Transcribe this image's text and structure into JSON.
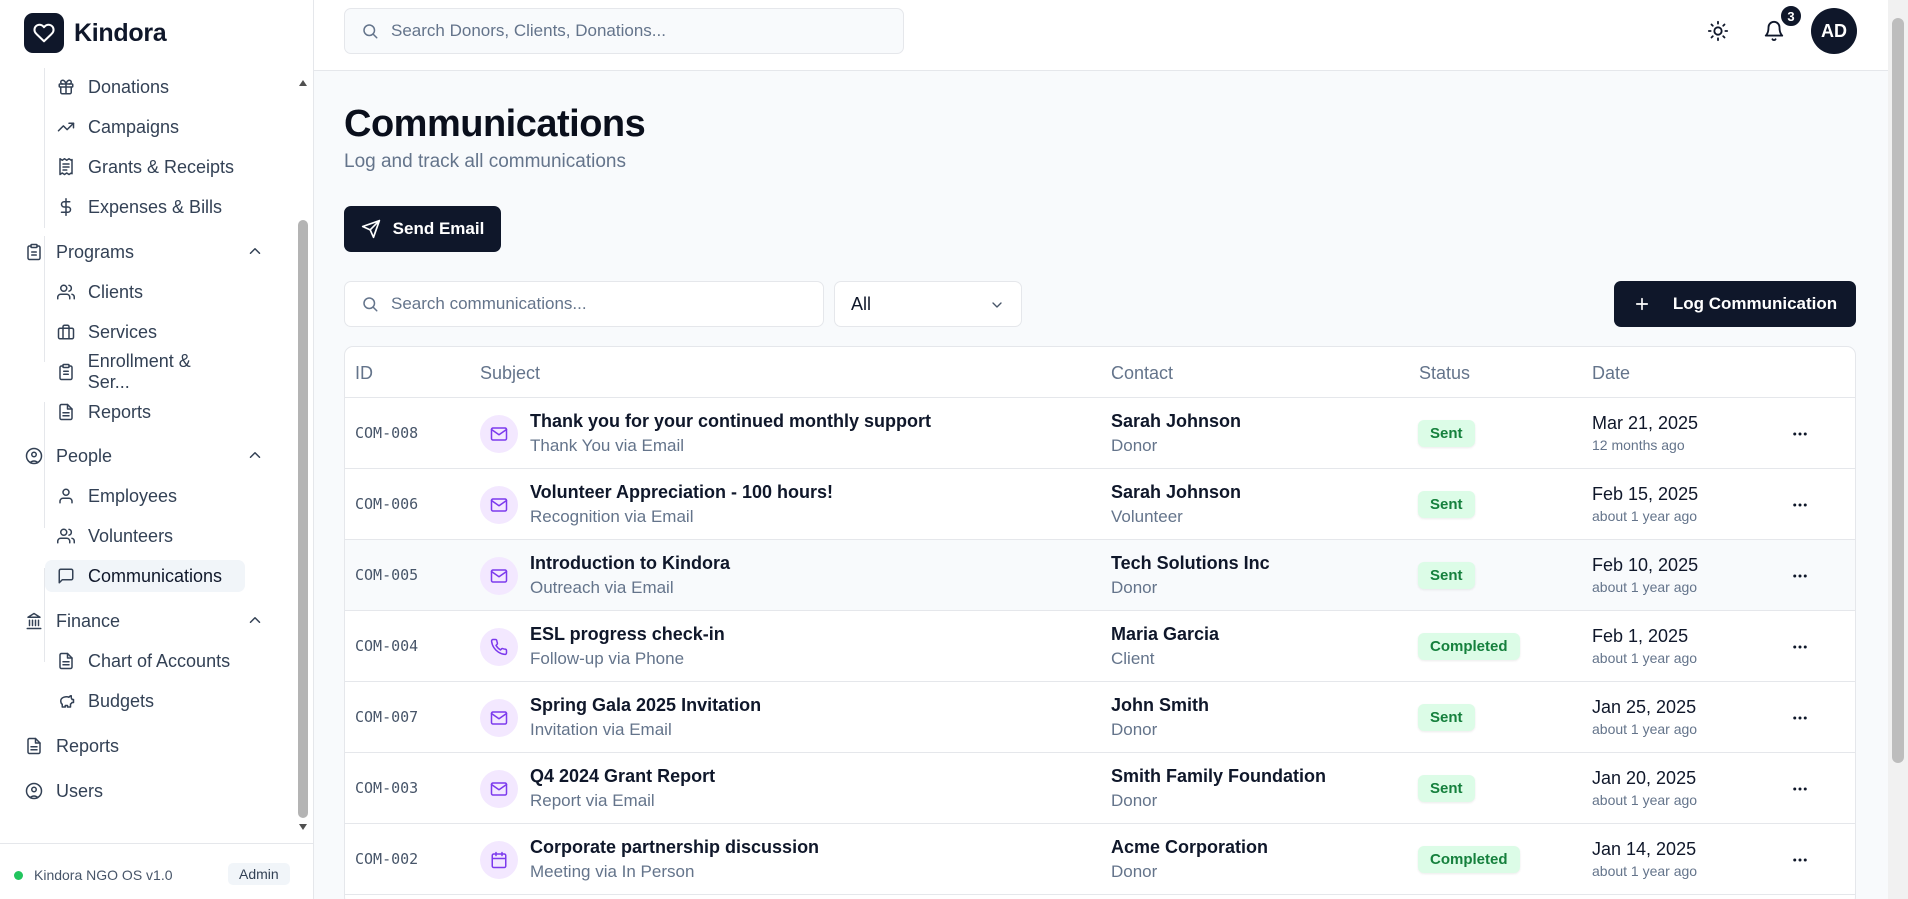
{
  "app": {
    "name": "Kindora"
  },
  "search": {
    "placeholder": "Search Donors, Clients, Donations..."
  },
  "notifications": {
    "count": "3"
  },
  "user": {
    "initials": "AD"
  },
  "sidebar": {
    "items": [
      {
        "label": "Donations",
        "icon": "gift-icon"
      },
      {
        "label": "Campaigns",
        "icon": "trending-up-icon"
      },
      {
        "label": "Grants & Receipts",
        "icon": "receipt-icon"
      },
      {
        "label": "Expenses & Bills",
        "icon": "dollar-icon"
      },
      {
        "label": "Programs",
        "icon": "clipboard-icon"
      },
      {
        "label": "Clients",
        "icon": "users-icon"
      },
      {
        "label": "Services",
        "icon": "briefcase-icon"
      },
      {
        "label": "Enrollment & Ser...",
        "icon": "clipboard-list-icon"
      },
      {
        "label": "Reports",
        "icon": "file-icon"
      },
      {
        "label": "People",
        "icon": "user-circle-icon"
      },
      {
        "label": "Employees",
        "icon": "user-icon"
      },
      {
        "label": "Volunteers",
        "icon": "users-icon"
      },
      {
        "label": "Communications",
        "icon": "message-square-icon"
      },
      {
        "label": "Finance",
        "icon": "landmark-icon"
      },
      {
        "label": "Chart of Accounts",
        "icon": "file-text-icon"
      },
      {
        "label": "Budgets",
        "icon": "piggy-bank-icon"
      },
      {
        "label": "Reports",
        "icon": "file-icon"
      },
      {
        "label": "Users",
        "icon": "user-circle-icon"
      }
    ],
    "footer": {
      "version": "Kindora NGO OS v1.0",
      "role": "Admin"
    }
  },
  "page": {
    "title": "Communications",
    "subtitle": "Log and track all communications",
    "send_email_label": "Send Email",
    "log_label": "Log Communication",
    "search_placeholder": "Search communications...",
    "filter_value": "All"
  },
  "table": {
    "headers": {
      "id": "ID",
      "subject": "Subject",
      "contact": "Contact",
      "status": "Status",
      "date": "Date"
    },
    "rows": [
      {
        "id": "COM-008",
        "subject": "Thank you for your continued monthly support",
        "detail": "Thank You via Email",
        "type": "mail-icon",
        "contact": "Sarah Johnson",
        "contact_type": "Donor",
        "status": "Sent",
        "date": "Mar 21, 2025",
        "relative": "12 months ago"
      },
      {
        "id": "COM-006",
        "subject": "Volunteer Appreciation - 100 hours!",
        "detail": "Recognition via Email",
        "type": "mail-icon",
        "contact": "Sarah Johnson",
        "contact_type": "Volunteer",
        "status": "Sent",
        "date": "Feb 15, 2025",
        "relative": "about 1 year ago"
      },
      {
        "id": "COM-005",
        "subject": "Introduction to Kindora",
        "detail": "Outreach via Email",
        "type": "mail-icon",
        "contact": "Tech Solutions Inc",
        "contact_type": "Donor",
        "status": "Sent",
        "date": "Feb 10, 2025",
        "relative": "about 1 year ago"
      },
      {
        "id": "COM-004",
        "subject": "ESL progress check-in",
        "detail": "Follow-up via Phone",
        "type": "phone-icon",
        "contact": "Maria Garcia",
        "contact_type": "Client",
        "status": "Completed",
        "date": "Feb 1, 2025",
        "relative": "about 1 year ago"
      },
      {
        "id": "COM-007",
        "subject": "Spring Gala 2025 Invitation",
        "detail": "Invitation via Email",
        "type": "mail-icon",
        "contact": "John Smith",
        "contact_type": "Donor",
        "status": "Sent",
        "date": "Jan 25, 2025",
        "relative": "about 1 year ago"
      },
      {
        "id": "COM-003",
        "subject": "Q4 2024 Grant Report",
        "detail": "Report via Email",
        "type": "mail-icon",
        "contact": "Smith Family Foundation",
        "contact_type": "Donor",
        "status": "Sent",
        "date": "Jan 20, 2025",
        "relative": "about 1 year ago"
      },
      {
        "id": "COM-002",
        "subject": "Corporate partnership discussion",
        "detail": "Meeting via In Person",
        "type": "calendar-icon",
        "contact": "Acme Corporation",
        "contact_type": "Donor",
        "status": "Completed",
        "date": "Jan 14, 2025",
        "relative": "about 1 year ago"
      }
    ]
  },
  "colors": {
    "primary": "#0f172a",
    "accent_purple": "#7c3aed",
    "status_green": "#15803d"
  }
}
